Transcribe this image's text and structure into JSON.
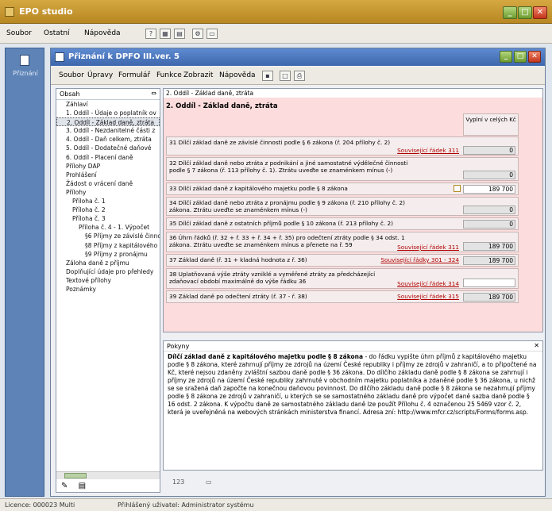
{
  "app": {
    "title": "EPO studio"
  },
  "menu": {
    "items": [
      "Soubor",
      "Ostatní",
      "Nápověda"
    ]
  },
  "toolbar": {
    "icons": [
      "help-icon",
      "grid-icon",
      "grid2-icon",
      "tool-icon",
      "window-icon"
    ]
  },
  "left_strip": {
    "label": "Přiznání"
  },
  "status": {
    "license": "Licence: 000023 Multi",
    "user": "Přihlášený uživatel: Administrator systému"
  },
  "inner": {
    "title": "Přiznání k DPFO III.ver. 5",
    "menu": [
      "Soubor",
      "Úpravy",
      "Formulář",
      "Funkce",
      "Zobrazit",
      "Nápověda"
    ]
  },
  "nav": {
    "header": "Obsah",
    "items": [
      "Záhlaví",
      "1. Oddíl - Údaje o poplatník ov",
      "2. Oddíl - Základ daně, ztráta",
      "3. Oddíl - Nezdanitelné části z",
      "4. Oddíl - Daň celkem, ztráta",
      "5. Oddíl - Dodatečné daňové",
      "6. Oddíl - Placení daně",
      "Přílohy DAP",
      "Prohlášení",
      "Žádost o vrácení daně",
      "Přílohy",
      "Příloha č. 1",
      "Příloha č. 2",
      "Příloha č. 3",
      "Příloha č. 4 - 1. Výpočet",
      "§6 Příjmy ze závislé činnost",
      "§8 Příjmy z kapitálového m",
      "§9 Příjmy z pronájmu",
      "Záloha daně z příjmu",
      "Doplňující údaje pro přehledy",
      "Textové přílohy",
      "Poznámky"
    ],
    "selected": 2
  },
  "form": {
    "breadcrumb": "2. Oddíl - Základ daně, ztráta",
    "heading": "2. Oddíl - Základ daně, ztráta",
    "col_header": "Vyplní v celých Kč",
    "rows": [
      {
        "label": "31 Dílčí základ daně ze závislé činnosti podle § 6 zákona (ř. 204 přílohy č. 2)",
        "related": "Související řádek 311",
        "value": "0"
      },
      {
        "label": "32 Dílčí základ daně nebo ztráta z podnikání a jiné samostatné výdělečné činnosti podle § 7 zákona (ř. 113 přílohy č. 1). Ztrátu uveďte se znaménkem mínus (-)",
        "related": "",
        "value": "0"
      },
      {
        "label": "33 Dílčí základ daně z kapitálového majetku podle § 8 zákona",
        "related": "",
        "value": "189 700"
      },
      {
        "label": "34 Dílčí základ daně nebo ztráta z pronájmu podle § 9 zákona (ř. 210 přílohy č. 2) zákona. Ztrátu uveďte se znaménkem mínus (-)",
        "related": "",
        "value": "0"
      },
      {
        "label": "35 Dílčí základ daně z ostatních příjmů podle § 10 zákona (ř. 213 přílohy č. 2)",
        "related": "",
        "value": "0"
      },
      {
        "label": "36 Úhrn řádků (ř. 32 + ř. 33 + ř. 34 + ř. 35) pro odečtení ztráty podle § 34 odst. 1 zákona. Ztrátu uveďte se znaménkem mínus a přenete na ř. 59",
        "related": "Související řádek 311",
        "value": "189 700"
      },
      {
        "label": "37 Základ daně (ř. 31 + kladná hodnota z ř. 36)",
        "related": "Související řádky 301 - 324",
        "value": "189 700"
      },
      {
        "label": "38 Uplatňovaná výše ztráty vzniklé a vyměřené ztráty za předcházející zdaňovací období maximálně do výše řádku 36",
        "related": "Související řádek 314",
        "value": ""
      },
      {
        "label": "39 Základ daně po odečtení ztráty (ř. 37 - ř. 38)",
        "related": "Související řádek 315",
        "value": "189 700"
      }
    ]
  },
  "help": {
    "header": "Pokyny",
    "title": "Dílčí základ daně z kapitálového majetku podle § 8 zákona",
    "body": " - do řádku vypište úhrn příjmů z kapitálového majetku podle § 8 zákona, které zahrnují příjmy ze zdrojů na území České republiky i příjmy ze zdrojů v zahraničí, a to připočtené na Kč, které nejsou zdaněny zvláštní sazbou daně podle § 36 zákona. Do dílčího základu daně podle § 8 zákona se zahrnují i příjmy ze zdrojů na území České republiky zahrnuté v obchodním majetku poplatníka a zdaněné podle § 36 zákona, u nichž se se sražená daň započte na konečnou daňovou povinnost. Do dílčího základu daně podle § 8 zákona se nezahrnují příjmy podle § 8 zákona ze zdrojů v zahraničí, u kterých se se samostatného základu daně pro výpočet daně sazba daně podle § 16 odst. 2 zákona. K výpočtu daně ze samostatného základu daně lze použít Přílohu č. 4 označenou 25 5469 vzor č. 2, která je uveřejněná na webových stránkách ministerstva financí. Adresa zní: http://www.mfcr.cz/scripts/Forms/forms.asp."
  },
  "bottom": {
    "page": "123"
  }
}
